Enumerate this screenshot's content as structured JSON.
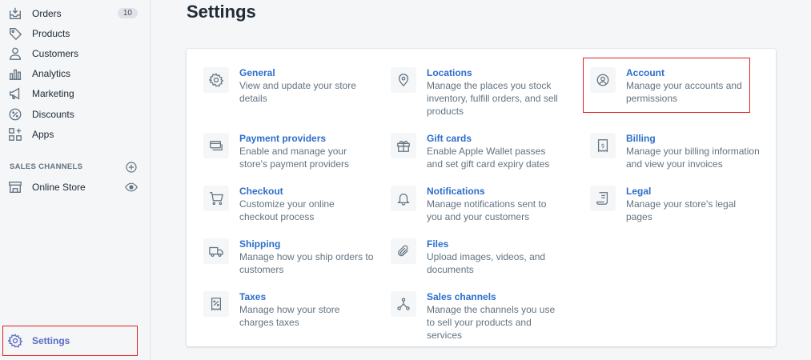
{
  "sidebar": {
    "items": [
      {
        "label": "Orders",
        "icon": "orders-icon",
        "badge": "10"
      },
      {
        "label": "Products",
        "icon": "tag-icon"
      },
      {
        "label": "Customers",
        "icon": "person-icon"
      },
      {
        "label": "Analytics",
        "icon": "bar-chart-icon"
      },
      {
        "label": "Marketing",
        "icon": "megaphone-icon"
      },
      {
        "label": "Discounts",
        "icon": "discount-icon"
      },
      {
        "label": "Apps",
        "icon": "apps-icon"
      }
    ],
    "sales_channels_label": "SALES CHANNELS",
    "online_store_label": "Online Store",
    "settings_label": "Settings"
  },
  "page": {
    "title": "Settings"
  },
  "settings_tiles": [
    {
      "title": "General",
      "desc": "View and update your store details",
      "icon": "gear-icon"
    },
    {
      "title": "Locations",
      "desc": "Manage the places you stock inventory, fulfill orders, and sell products",
      "icon": "location-pin-icon"
    },
    {
      "title": "Account",
      "desc": "Manage your accounts and permissions",
      "icon": "account-icon"
    },
    {
      "title": "Payment providers",
      "desc": "Enable and manage your store's payment providers",
      "icon": "payment-icon"
    },
    {
      "title": "Gift cards",
      "desc": "Enable Apple Wallet passes and set gift card expiry dates",
      "icon": "gift-icon"
    },
    {
      "title": "Billing",
      "desc": "Manage your billing information and view your invoices",
      "icon": "receipt-icon"
    },
    {
      "title": "Checkout",
      "desc": "Customize your online checkout process",
      "icon": "cart-icon"
    },
    {
      "title": "Notifications",
      "desc": "Manage notifications sent to you and your customers",
      "icon": "bell-icon"
    },
    {
      "title": "Legal",
      "desc": "Manage your store's legal pages",
      "icon": "legal-icon"
    },
    {
      "title": "Shipping",
      "desc": "Manage how you ship orders to customers",
      "icon": "truck-icon"
    },
    {
      "title": "Files",
      "desc": "Upload images, videos, and documents",
      "icon": "paperclip-icon"
    },
    {
      "title": "Taxes",
      "desc": "Manage how your store charges taxes",
      "icon": "tax-icon"
    },
    {
      "title": "Sales channels",
      "desc": "Manage the channels you use to sell your products and services",
      "icon": "channels-icon"
    }
  ],
  "colors": {
    "accent": "#5c6ac4",
    "link": "#2c6ecb",
    "highlight": "#e02020"
  }
}
